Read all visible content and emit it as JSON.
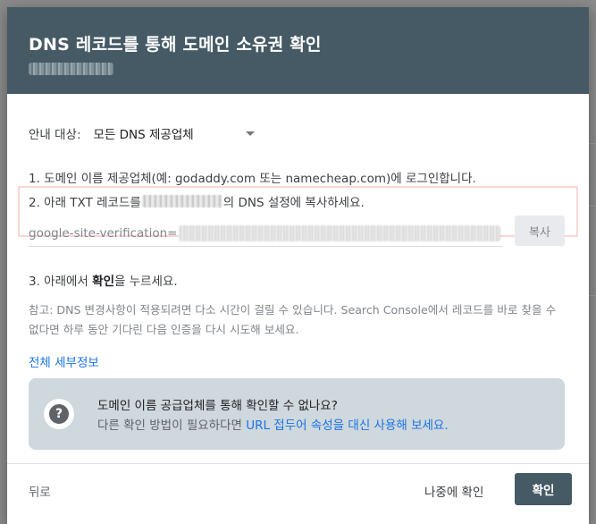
{
  "dialog": {
    "title": "DNS 레코드를 통해 도메인 소유권 확인"
  },
  "instructions": {
    "target_label": "안내 대상:",
    "target_value": "모든 DNS 제공업체",
    "step1": "1. 도메인 이름 제공업체(예: godaddy.com 또는 namecheap.com)에 로그인합니다.",
    "step2_prefix": "2. 아래 TXT 레코드를",
    "step2_suffix": "의 DNS 설정에 복사하세요.",
    "txt_record_prefix": "google-site-verification=",
    "copy_label": "복사",
    "step3_prefix": "3. 아래에서 ",
    "step3_bold": "확인",
    "step3_suffix": "을 누르세요.",
    "note": "참고: DNS 변경사항이 적용되려면 다소 시간이 걸릴 수 있습니다. Search Console에서 레코드를 바로 찾을 수 없다면 하루 동안 기다린 다음 인증을 다시 시도해 보세요.",
    "details_link": "전체 세부정보"
  },
  "help": {
    "icon": "help-question-icon",
    "title": "도메인 이름 공급업체를 통해 확인할 수 없나요?",
    "text": "다른 확인 방법이 필요하다면 ",
    "link": "URL 접두어 속성을 대신 사용해 보세요."
  },
  "footer": {
    "back_label": "뒤로",
    "later_label": "나중에 확인",
    "confirm_label": "확인"
  },
  "colors": {
    "header_bg": "#455a64",
    "link": "#1a73e8",
    "help_bg": "#cfd8dc",
    "highlight_border": "#fbd5d5"
  }
}
